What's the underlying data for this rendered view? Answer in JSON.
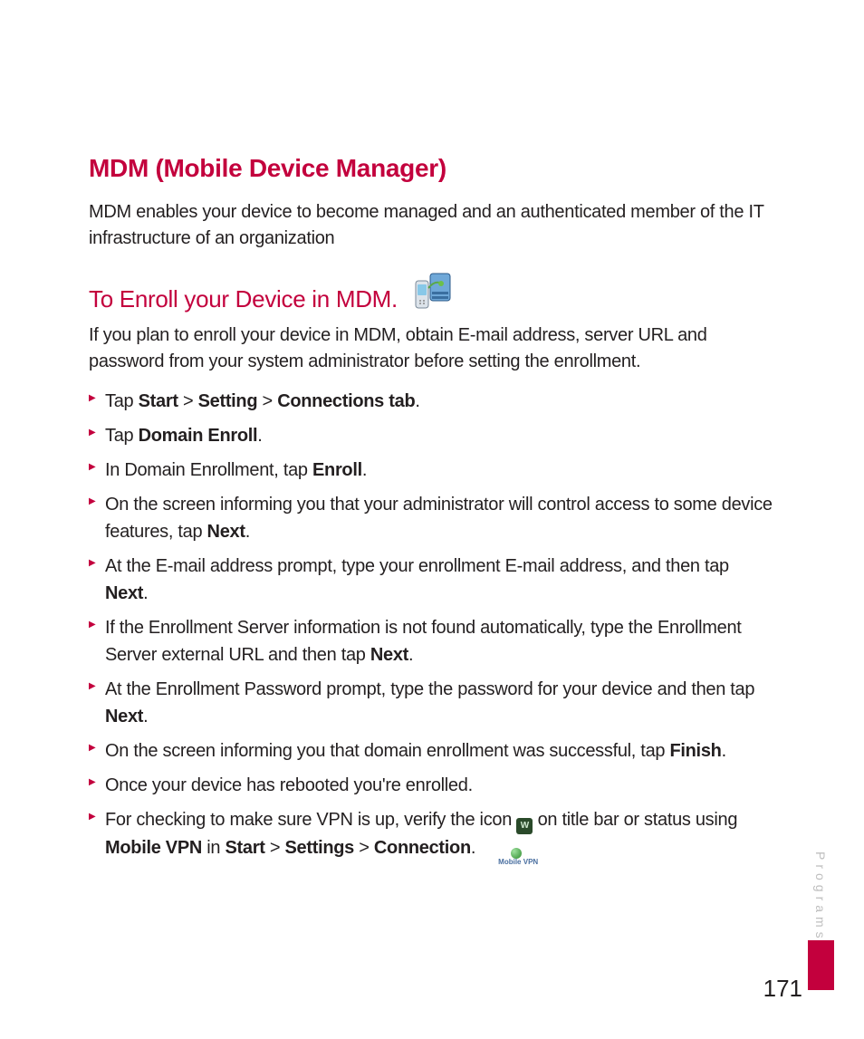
{
  "section_title": "MDM (Mobile Device Manager)",
  "intro": "MDM enables your device to become managed and an authenticated member of the IT infrastructure of an organization",
  "sub_title": "To Enroll your Device in MDM.",
  "sub_body": "If you plan to enroll your device in MDM, obtain E-mail address, server URL and password from your system administrator before setting the enrollment.",
  "steps": [
    {
      "pre": "Tap ",
      "b1": "Start",
      "mid1": " > ",
      "b2": "Setting",
      "mid2": " > ",
      "b3": "Connections tab",
      "post": "."
    },
    {
      "pre": "Tap ",
      "b1": "Domain Enroll",
      "post": "."
    },
    {
      "pre": "In Domain Enrollment, tap ",
      "b1": "Enroll",
      "post": "."
    },
    {
      "pre": "On the screen informing you that your administrator will control access to some device features, tap ",
      "b1": "Next",
      "post": "."
    },
    {
      "pre": "At the E-mail address prompt, type your enrollment E-mail address, and then tap ",
      "b1": "Next",
      "post": "."
    },
    {
      "pre": "If the Enrollment Server information is not found automatically, type the Enrollment Server external URL and then tap ",
      "b1": "Next",
      "post": "."
    },
    {
      "pre": "At the Enrollment Password prompt, type the password for your device and then tap ",
      "b1": "Next",
      "post": "."
    },
    {
      "pre": "On the screen informing you that domain enrollment was successful, tap ",
      "b1": "Finish",
      "post": "."
    },
    {
      "pre": "Once your device has rebooted you're enrolled."
    }
  ],
  "step_vpn": {
    "pre": "For checking to make sure VPN is up, verify the icon ",
    "mid": " on title bar or status using ",
    "b1": "Mobile VPN",
    "mid2": " in ",
    "b2": "Start",
    "sep1": " > ",
    "b3": "Settings",
    "sep2": " > ",
    "b4": "Connection",
    "post": "."
  },
  "vpn_badge_text": "W",
  "mvpn_label": "Mobile VPN",
  "side_tab": "Programs",
  "page_number": "171"
}
